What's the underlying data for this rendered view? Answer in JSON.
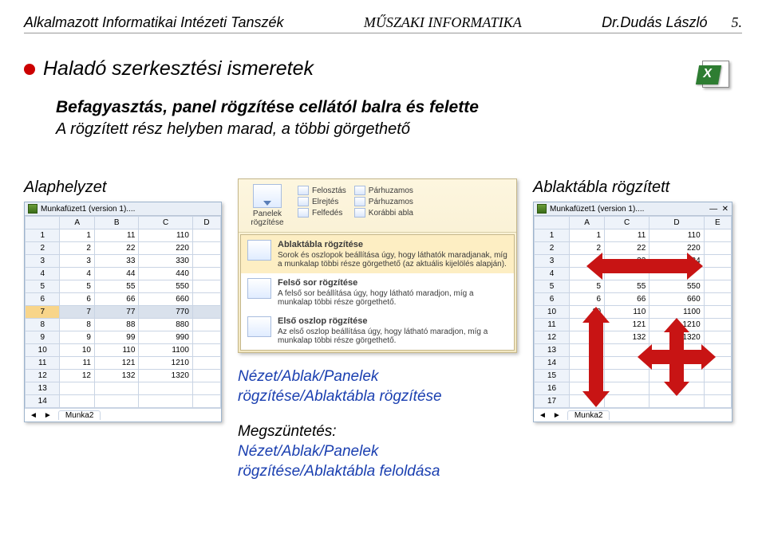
{
  "header": {
    "left": "Alkalmazott Informatikai Intézeti Tanszék",
    "center": "MŰSZAKI INFORMATIKA",
    "right_author": "Dr.Dudás László",
    "right_page": "5."
  },
  "title": "Haladó szerkesztési ismeretek",
  "subtitle_bold": "Befagyasztás, panel rögzítése cellától balra és felette",
  "subtitle_reg": "A rögzített rész helyben marad, a többi görgethető",
  "left_label": "Alaphelyzet",
  "right_label": "Ablaktábla rögzített",
  "mid_command": "Nézet/Ablak/Panelek rögzítése/Ablaktábla rögzítése",
  "mid_undo_label": "Megszüntetés:",
  "mid_undo_cmd": "Nézet/Ablak/Panelek rögzítése/Ablaktábla feloldása",
  "sheetLeft": {
    "title": "Munkafüzet1 (version 1)....",
    "cols": [
      "A",
      "B",
      "C",
      "D"
    ],
    "rows": [
      [
        "1",
        "1",
        "11",
        "110",
        ""
      ],
      [
        "2",
        "2",
        "22",
        "220",
        ""
      ],
      [
        "3",
        "3",
        "33",
        "330",
        ""
      ],
      [
        "4",
        "4",
        "44",
        "440",
        ""
      ],
      [
        "5",
        "5",
        "55",
        "550",
        ""
      ],
      [
        "6",
        "6",
        "66",
        "660",
        ""
      ],
      [
        "7",
        "7",
        "77",
        "770",
        ""
      ],
      [
        "8",
        "8",
        "88",
        "880",
        ""
      ],
      [
        "9",
        "9",
        "99",
        "990",
        ""
      ],
      [
        "10",
        "10",
        "110",
        "1100",
        ""
      ],
      [
        "11",
        "11",
        "121",
        "1210",
        ""
      ],
      [
        "12",
        "12",
        "132",
        "1320",
        ""
      ],
      [
        "13",
        "",
        "",
        "",
        ""
      ],
      [
        "14",
        "",
        "",
        "",
        ""
      ]
    ],
    "selected_row": 7,
    "tab": "Munka2"
  },
  "sheetRight": {
    "title": "Munkafüzet1 (version 1)....",
    "cols": [
      "A",
      "C",
      "D",
      "E"
    ],
    "rows": [
      [
        "1",
        "1",
        "11",
        "110",
        ""
      ],
      [
        "2",
        "2",
        "22",
        "220",
        ""
      ],
      [
        "3",
        "3",
        "33",
        "334",
        ""
      ],
      [
        "4",
        "",
        "",
        "",
        ""
      ],
      [
        "5",
        "5",
        "55",
        "550",
        ""
      ],
      [
        "6",
        "6",
        "66",
        "660",
        ""
      ],
      [
        "10",
        "10",
        "110",
        "1100",
        ""
      ],
      [
        "11",
        "11",
        "121",
        "1210",
        ""
      ],
      [
        "12",
        "12",
        "132",
        "1320",
        ""
      ],
      [
        "13",
        "",
        "",
        "",
        ""
      ],
      [
        "14",
        "",
        "",
        "",
        ""
      ],
      [
        "15",
        "",
        "",
        "",
        ""
      ],
      [
        "16",
        "",
        "",
        "",
        ""
      ],
      [
        "17",
        "",
        "",
        "",
        ""
      ]
    ],
    "tab": "Munka2"
  },
  "ribbon": {
    "big_button": "Panelek rögzítése",
    "small": [
      "Felosztás",
      "Elrejtés",
      "Felfedés",
      "Párhuzamos",
      "Párhuzamos",
      "Korábbi abla"
    ],
    "dropdown": [
      {
        "title": "Ablaktábla rögzítése",
        "desc": "Sorok és oszlopok beállítása úgy, hogy láthatók maradjanak, míg a munkalap többi része görgethető (az aktuális kijelölés alapján)."
      },
      {
        "title": "Felső sor rögzítése",
        "desc": "A felső sor beállítása úgy, hogy látható maradjon, míg a munkalap többi része görgethető."
      },
      {
        "title": "Első oszlop rögzítése",
        "desc": "Az első oszlop beállítása úgy, hogy látható maradjon, míg a munkalap többi része görgethető."
      }
    ]
  }
}
